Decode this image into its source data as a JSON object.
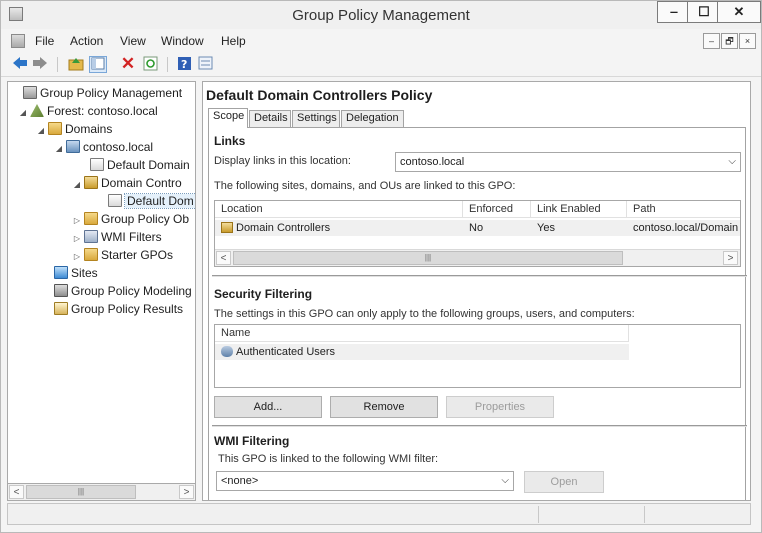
{
  "window": {
    "title": "Group Policy Management",
    "controls": {
      "minimize": "‒",
      "maximize": "☐",
      "close": "✕"
    }
  },
  "menubar": {
    "items": [
      "File",
      "Action",
      "View",
      "Window",
      "Help"
    ],
    "mdi": {
      "minimize": "‒",
      "restore": "🗗",
      "close": "×"
    }
  },
  "toolbar": {
    "icons": [
      "back-arrow-icon",
      "forward-arrow-icon",
      "up-folder-icon",
      "show-hide-tree-icon",
      "delete-icon",
      "refresh-icon",
      "help-icon",
      "view-icon"
    ]
  },
  "tree": {
    "items": [
      {
        "label": "Group Policy Management",
        "icon": "gpm-icon",
        "expander": ""
      },
      {
        "label": "Forest: contoso.local",
        "icon": "forest-icon",
        "expander": "◢"
      },
      {
        "label": "Domains",
        "icon": "domains-folder-icon",
        "expander": "◢"
      },
      {
        "label": "contoso.local",
        "icon": "domain-icon",
        "expander": "◢"
      },
      {
        "label": "Default Domain",
        "icon": "gpo-link-icon",
        "expander": ""
      },
      {
        "label": "Domain Contro",
        "icon": "ou-icon",
        "expander": "◢"
      },
      {
        "label": "Default Dom",
        "icon": "gpo-link-icon",
        "expander": ""
      },
      {
        "label": "Group Policy Ob",
        "icon": "gpo-folder-icon",
        "expander": "▷"
      },
      {
        "label": "WMI Filters",
        "icon": "wmi-folder-icon",
        "expander": "▷"
      },
      {
        "label": "Starter GPOs",
        "icon": "starter-folder-icon",
        "expander": "▷"
      },
      {
        "label": "Sites",
        "icon": "sites-icon",
        "expander": ""
      },
      {
        "label": "Group Policy Modeling",
        "icon": "modeling-icon",
        "expander": ""
      },
      {
        "label": "Group Policy Results",
        "icon": "results-icon",
        "expander": ""
      }
    ],
    "scroll_thumb": "|||"
  },
  "right": {
    "title": "Default Domain Controllers Policy",
    "tabs": [
      "Scope",
      "Details",
      "Settings",
      "Delegation"
    ],
    "active_tab": "Scope",
    "links": {
      "heading": "Links",
      "display_label": "Display links in this location:",
      "location_value": "contoso.local",
      "description": "The following sites, domains, and OUs are linked to this GPO:",
      "columns": [
        "Location",
        "Enforced",
        "Link Enabled",
        "Path"
      ],
      "rows": [
        {
          "location": "Domain Controllers",
          "enforced": "No",
          "link_enabled": "Yes",
          "path": "contoso.local/Domain Co"
        }
      ],
      "scroll_thumb": "|||"
    },
    "security": {
      "heading": "Security Filtering",
      "description": "The settings in this GPO can only apply to the following groups, users, and computers:",
      "columns": [
        "Name"
      ],
      "rows": [
        "Authenticated Users"
      ],
      "buttons": {
        "add": "Add...",
        "remove": "Remove",
        "properties": "Properties"
      }
    },
    "wmi": {
      "heading": "WMI Filtering",
      "description": "This GPO is linked to the following WMI filter:",
      "filter_value": "<none>",
      "open_button": "Open"
    }
  },
  "colors": {
    "accent": "#0063b1",
    "window_bg": "#f4f4f4",
    "selected_row": "#e5f1fb"
  }
}
